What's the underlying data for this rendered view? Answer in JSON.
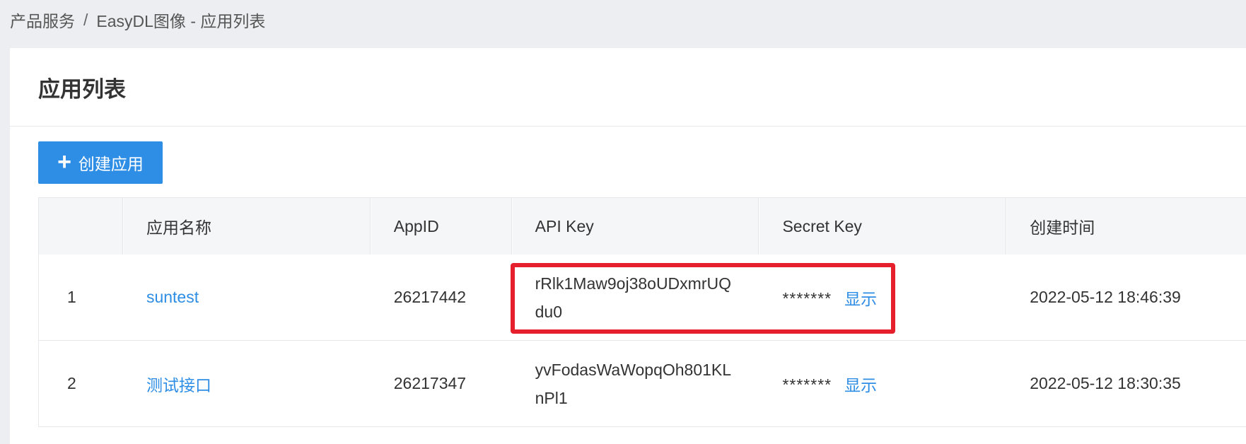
{
  "breadcrumb": {
    "items": [
      "产品服务",
      "EasyDL图像 - 应用列表"
    ],
    "separator": "/"
  },
  "page": {
    "title": "应用列表"
  },
  "toolbar": {
    "create_label": "创建应用",
    "create_icon": "plus-icon"
  },
  "table": {
    "headers": [
      "",
      "应用名称",
      "AppID",
      "API Key",
      "Secret Key",
      "创建时间"
    ],
    "rows": [
      {
        "index": "1",
        "name": "suntest",
        "app_id": "26217442",
        "api_key": "rRlk1Maw9oj38oUDxmrUQdu0",
        "secret_masked": "*******",
        "show_label": "显示",
        "created": "2022-05-12 18:46:39"
      },
      {
        "index": "2",
        "name": "测试接口",
        "app_id": "26217347",
        "api_key": "yvFodasWaWopqOh801KLnPl1",
        "secret_masked": "*******",
        "show_label": "显示",
        "created": "2022-05-12 18:30:35"
      }
    ]
  },
  "colors": {
    "accent": "#2e8de4",
    "highlight": "#e5202c",
    "background": "#eceef2"
  }
}
